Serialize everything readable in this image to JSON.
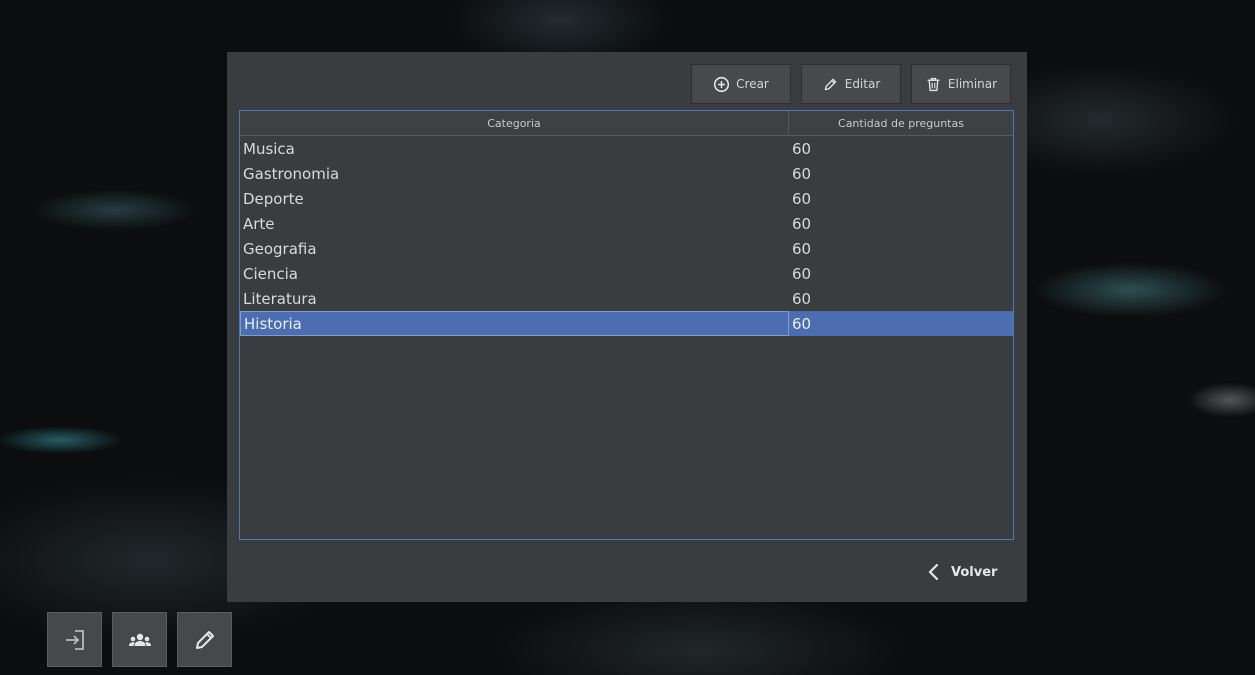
{
  "toolbar": {
    "create_label": "Crear",
    "edit_label": "Editar",
    "delete_label": "Eliminar",
    "icons": [
      "plus-circle-icon",
      "pencil-icon",
      "trash-icon"
    ]
  },
  "table": {
    "columns": [
      "Categoria",
      "Cantidad de preguntas"
    ],
    "rows": [
      {
        "categoria": "Musica",
        "cantidad": "60"
      },
      {
        "categoria": "Gastronomia",
        "cantidad": "60"
      },
      {
        "categoria": "Deporte",
        "cantidad": "60"
      },
      {
        "categoria": "Arte",
        "cantidad": "60"
      },
      {
        "categoria": "Geografia",
        "cantidad": "60"
      },
      {
        "categoria": "Ciencia",
        "cantidad": "60"
      },
      {
        "categoria": "Literatura",
        "cantidad": "60"
      },
      {
        "categoria": "Historia",
        "cantidad": "60"
      }
    ],
    "selected_index": 7
  },
  "footer": {
    "back_label": "Volver"
  },
  "dock": {
    "icons": [
      "login-icon",
      "users-icon",
      "pencil-icon"
    ]
  },
  "colors": {
    "panel_bg": "#3a3d40",
    "selection": "#4c6eb1",
    "table_border": "#4f77b3"
  }
}
